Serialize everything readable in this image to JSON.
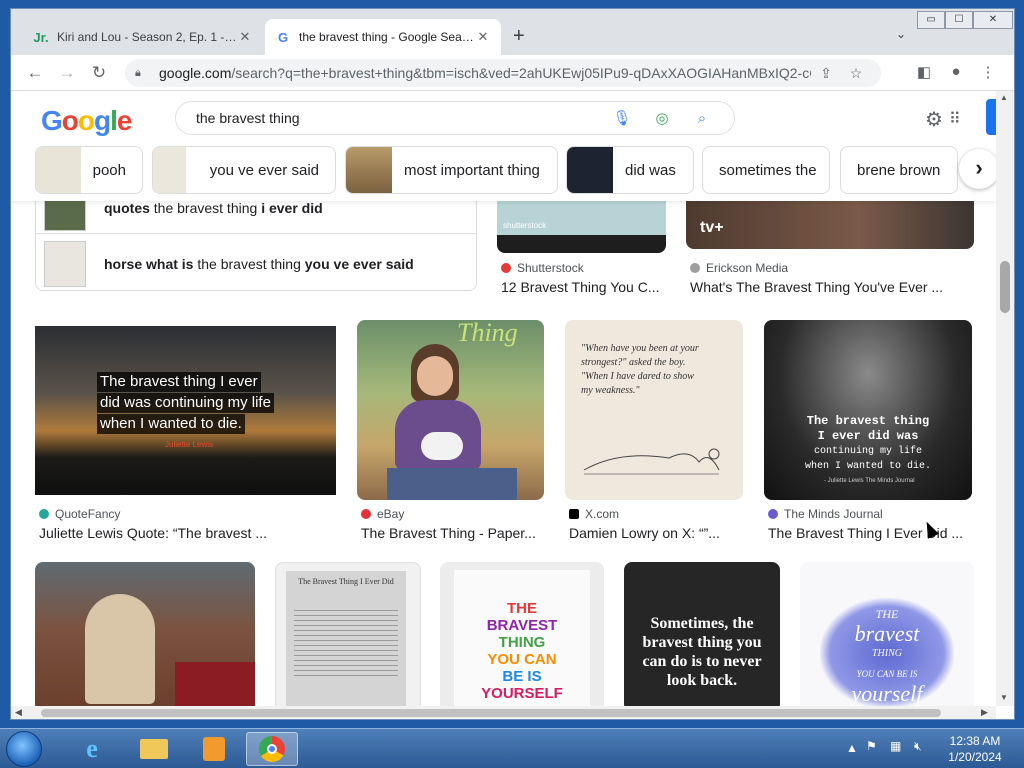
{
  "browser": {
    "tabs": [
      {
        "title": "Kiri and Lou - Season 2, Ep. 1 - SI",
        "favicon": "kiri-icon",
        "active": false
      },
      {
        "title": "the bravest thing - Google Search",
        "favicon": "google-g-icon",
        "active": true
      }
    ],
    "new_tab": "+",
    "window_controls": {
      "minimize": "▭",
      "maximize": "☐",
      "close": "✕"
    },
    "url_domain": "google.com",
    "url_rest": "/search?q=the+bravest+thing&tbm=isch&ved=2ahUKEwj05IPu9-qDAxXAOGIAHanMBxIQ2-cCe..."
  },
  "google": {
    "logo": [
      "G",
      "o",
      "o",
      "g",
      "l",
      "e"
    ],
    "logo_colors": [
      "#4285f4",
      "#ea4335",
      "#fbbc05",
      "#4285f4",
      "#34a853",
      "#ea4335"
    ],
    "query": "the bravest thing",
    "chips": [
      "pooh",
      "you ve ever said",
      "most important thing",
      "did was",
      "sometimes the",
      "brene brown"
    ]
  },
  "related": [
    {
      "bold1": "quotes",
      "normal": " the bravest thing ",
      "bold2": "i ever did"
    },
    {
      "bold1": "horse what is",
      "normal": " the bravest thing ",
      "bold2": "you ve ever said"
    }
  ],
  "results_top": [
    {
      "source": "Shutterstock",
      "caption": "12 Bravest Thing You C...",
      "color": "#e53935",
      "thumb_text": "shutterstock"
    },
    {
      "source": "Erickson Media",
      "caption": "What's The Bravest Thing You've Ever ...",
      "color": "#9e9e9e",
      "thumb_text": "tv+"
    }
  ],
  "results_row1": [
    {
      "source": "QuoteFancy",
      "caption": "Juliette Lewis Quote: “The bravest ...",
      "color": "#26a69a",
      "quote_lines": [
        "The bravest thing I ever",
        "did was continuing my life",
        "when I wanted to die."
      ],
      "attribution": "Juliette Lewis"
    },
    {
      "source": "eBay",
      "caption": "The Bravest Thing - Paper...",
      "color": "#e53238",
      "book_title": "Thing"
    },
    {
      "source": "X.com",
      "caption": "Damien Lowry  on X: “”...",
      "color": "#000000",
      "hand_lines": [
        "\"When have you been at your",
        "strongest?\" asked the boy.",
        "\"When I have dared to show",
        "my weakness.\""
      ]
    },
    {
      "source": "The Minds Journal",
      "caption": "The Bravest Thing I Ever Did ...",
      "color": "#6a5acd",
      "quote_lines": [
        "The bravest thing",
        "I ever did was",
        "continuing my life",
        "when I wanted to die."
      ],
      "attribution": "- Juliette Lewis  The Minds Journal"
    }
  ],
  "results_row2": [
    {
      "title": ""
    },
    {
      "title": "The Bravest Thing I Ever Did"
    },
    {
      "lines": [
        "THE",
        "BRAVEST",
        "THING",
        "YOU CAN",
        "BE IS",
        "YOURSELF"
      ]
    },
    {
      "lines": [
        "Sometimes, the",
        "bravest thing you",
        "can do is to never",
        "look back."
      ]
    },
    {
      "lines": [
        "THE",
        "bravest",
        "THING",
        "YOU CAN BE IS",
        "yourself"
      ]
    }
  ],
  "taskbar": {
    "time": "12:38 AM",
    "date": "1/20/2024"
  }
}
